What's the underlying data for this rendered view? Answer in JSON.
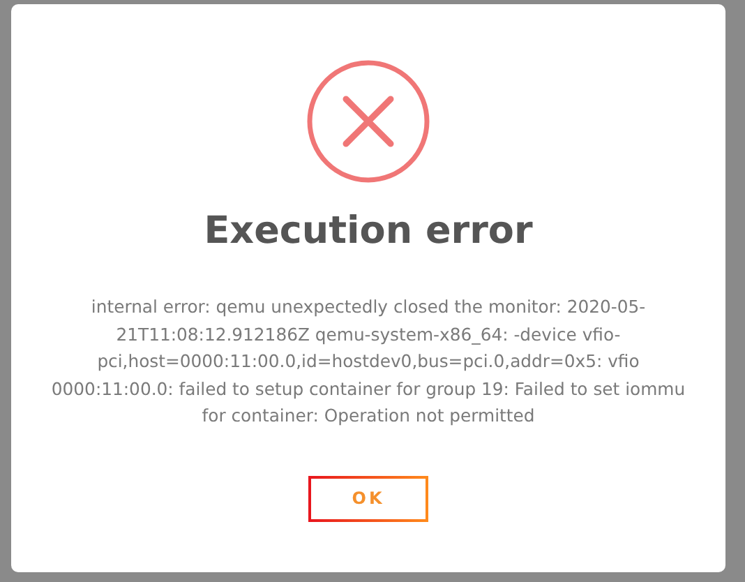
{
  "dialog": {
    "kind": "error",
    "title": "Execution error",
    "message": "internal error: qemu unexpectedly closed the monitor: 2020-05-21T11:08:12.912186Z qemu-system-x86_64: -device vfio-pci,host=0000:11:00.0,id=hostdev0,bus=pci.0,addr=0x5: vfio 0000:11:00.0: failed to setup container for group 19: Failed to set iommu for container: Operation not permitted",
    "buttons": [
      "OK"
    ]
  }
}
